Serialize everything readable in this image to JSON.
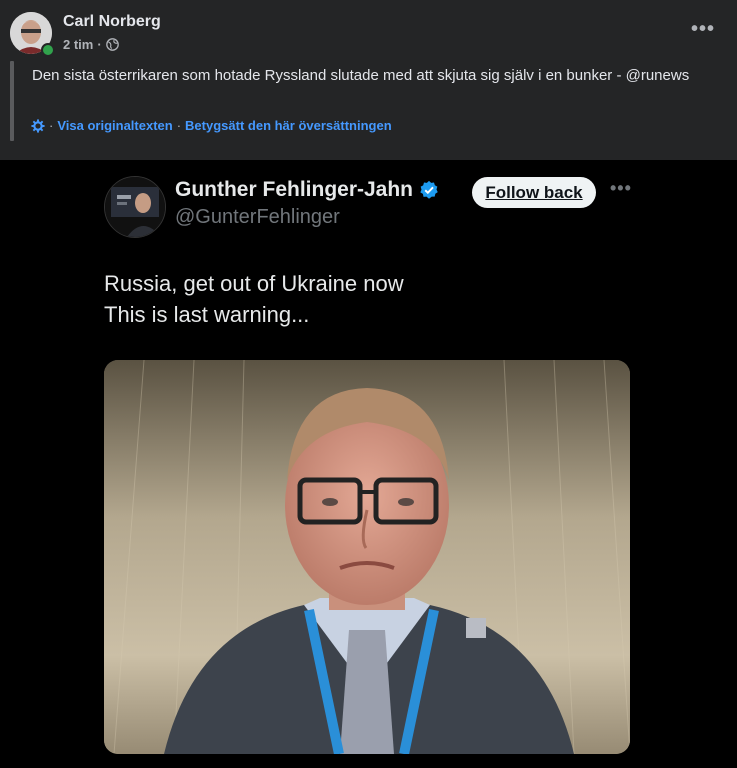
{
  "post": {
    "author": "Carl Norberg",
    "time": "2 tim",
    "audience_icon": "globe-icon",
    "more_icon": "more-horizontal-icon",
    "text": "Den sista österrikaren som hotade Ryssland slutade med att skjuta sig själv i en bunker - @runews",
    "translation": {
      "icon": "gear-icon",
      "separator": "·",
      "show_original": "Visa originaltexten",
      "rate": "Betygsätt den här översättningen"
    }
  },
  "embedded_tweet": {
    "name": "Gunther Fehlinger-Jahn",
    "handle": "@GunterFehlinger",
    "follow_label": "Follow back",
    "text_line1": "Russia, get out of Ukraine now",
    "text_line2": "This is last warning..."
  },
  "colors": {
    "background": "#242526",
    "media_background": "#000000",
    "link": "#4599ff",
    "verified": "#1d9bf0"
  }
}
